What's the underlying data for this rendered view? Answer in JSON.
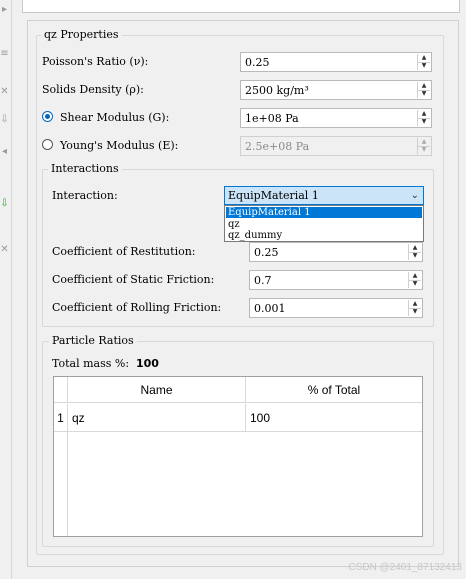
{
  "panel": {
    "title": "qz Properties"
  },
  "properties": {
    "poisson": {
      "label": "Poisson's Ratio (ν):",
      "value": "0.25"
    },
    "density": {
      "label": "Solids Density (ρ):",
      "value": "2500 kg/m³"
    },
    "shear": {
      "label": "Shear Modulus (G):",
      "value": "1e+08 Pa",
      "selected": true
    },
    "youngs": {
      "label": "Young's Modulus (E):",
      "value": "2.5e+08 Pa",
      "selected": false
    }
  },
  "interactions": {
    "title": "Interactions",
    "interaction_label": "Interaction:",
    "interaction_value": "EquipMaterial 1",
    "options": [
      "EquipMaterial 1",
      "qz",
      "qz_dummy"
    ],
    "restitution": {
      "label": "Coefficient of Restitution:",
      "value": "0.25"
    },
    "static_friction": {
      "label": "Coefficient of Static Friction:",
      "value": "0.7"
    },
    "rolling_friction": {
      "label": "Coefficient of Rolling Friction:",
      "value": "0.001"
    }
  },
  "particle_ratios": {
    "title": "Particle Ratios",
    "total_mass_label": "Total mass %:",
    "total_mass_value": "100",
    "columns": [
      "Name",
      "% of Total"
    ],
    "rows": [
      {
        "index": "1",
        "name": "qz",
        "percent": "100"
      }
    ]
  },
  "watermark": "CSDN @2401_87132413",
  "colors": {
    "accent": "#0078d7",
    "combo_bg": "#cce4f7"
  }
}
